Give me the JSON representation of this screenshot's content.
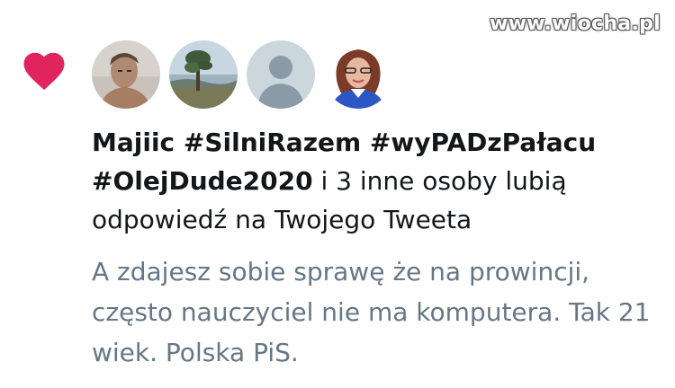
{
  "watermark": "www.wiocha.pl",
  "icons": {
    "like": "heart-icon"
  },
  "colors": {
    "like": "#e0245e",
    "primary_text": "#14171a",
    "secondary_text": "#657786"
  },
  "notification": {
    "actor": "Majiic #SilniRazem #wyPADzPałacu #OlejDude2020",
    "rest": " i 3 inne osoby lubią odpowiedź na Twojego Tweeta"
  },
  "reply_text": "A zdajesz sobie sprawę że na prowincji, często nauczyciel nie ma komputera. Tak 21 wiek. Polska PiS."
}
